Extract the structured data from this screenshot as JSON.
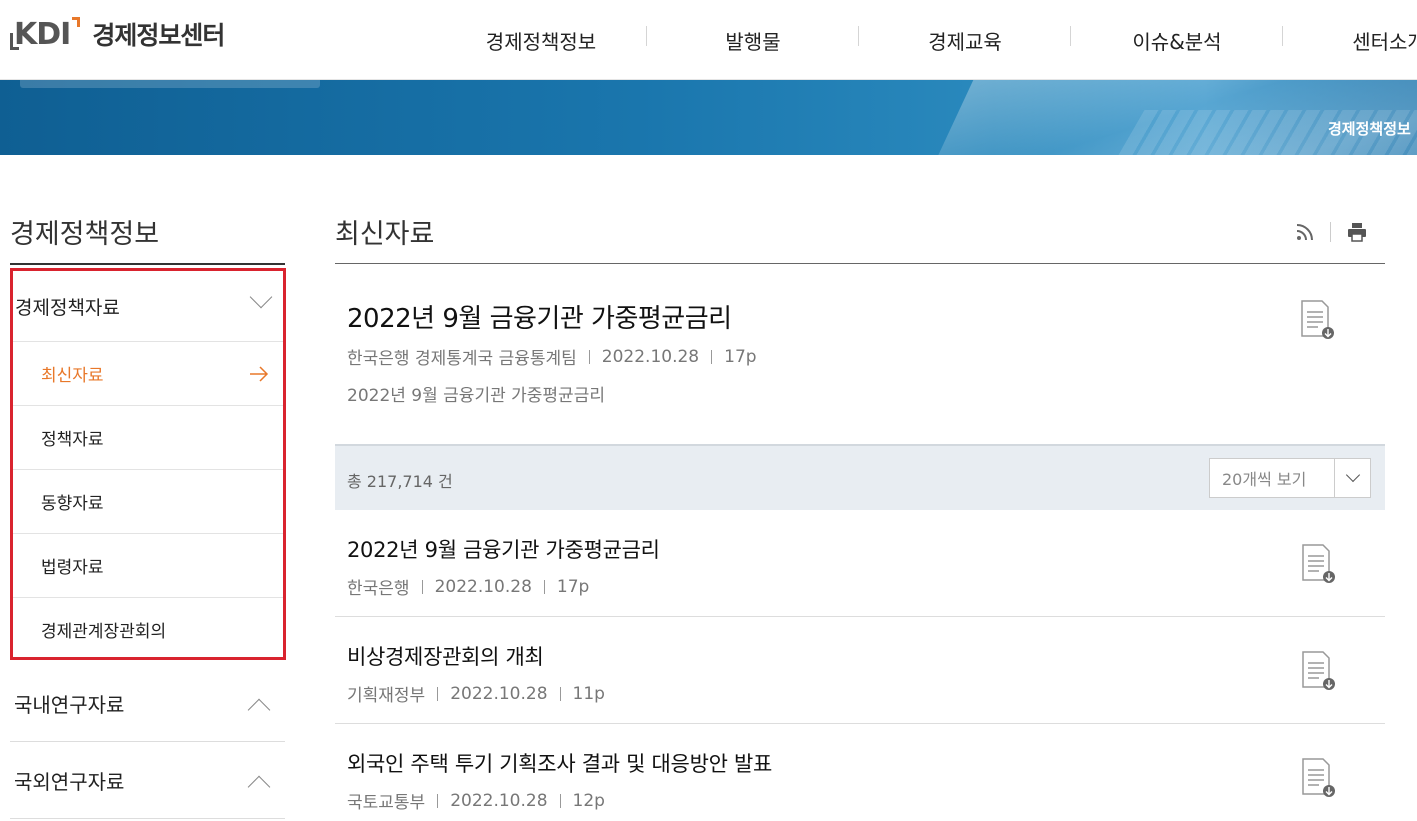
{
  "logo": {
    "brand": "KDI",
    "name": "경제정보센터"
  },
  "gnb": [
    "경제정책정보",
    "발행물",
    "경제교육",
    "이슈&분석",
    "센터소개"
  ],
  "banner": {
    "breadcrumb": "경제정책정보"
  },
  "sidebar": {
    "title": "경제정책정보",
    "groups": [
      {
        "label": "경제정책자료",
        "state": "expanded",
        "items": [
          {
            "label": "최신자료",
            "active": true
          },
          {
            "label": "정책자료"
          },
          {
            "label": "동향자료"
          },
          {
            "label": "법령자료"
          },
          {
            "label": "경제관계장관회의"
          }
        ]
      },
      {
        "label": "국내연구자료",
        "state": "collapsed"
      },
      {
        "label": "국외연구자료",
        "state": "collapsed"
      }
    ]
  },
  "main": {
    "title": "최신자료",
    "tools": {
      "rss": "rss-icon",
      "print": "print-icon"
    },
    "featured": {
      "title": "2022년 9월 금융기관 가중평균금리",
      "source": "한국은행 경제통계국 금융통계팀",
      "date": "2022.10.28",
      "pages": "17p",
      "desc": "2022년 9월 금융기관 가중평균금리"
    },
    "count": "총 217,714 건",
    "page_size": "20개씩 보기",
    "list": [
      {
        "title": "2022년 9월 금융기관 가중평균금리",
        "source": "한국은행",
        "date": "2022.10.28",
        "pages": "17p"
      },
      {
        "title": "비상경제장관회의 개최",
        "source": "기획재정부",
        "date": "2022.10.28",
        "pages": "11p"
      },
      {
        "title": "외국인 주택 투기 기획조사 결과 및 대응방안 발표",
        "source": "국토교통부",
        "date": "2022.10.28",
        "pages": "12p"
      }
    ]
  },
  "colors": {
    "accent": "#e8782a",
    "highlight_box": "#d9232e",
    "banner": "#1a76ad"
  }
}
